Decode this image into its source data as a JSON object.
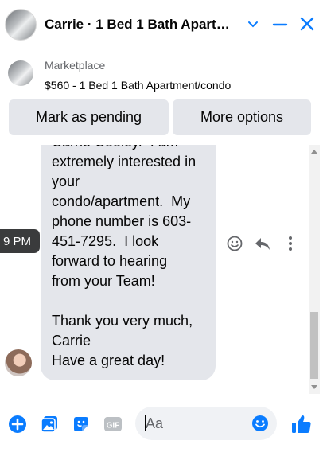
{
  "header": {
    "title": "Carrie · 1 Bed 1 Bath Apart…"
  },
  "marketplace": {
    "label": "Marketplace",
    "listing": "$560 - 1 Bed 1 Bath Apartment/condo",
    "pending_button": "Mark as pending",
    "more_button": "More options"
  },
  "chat": {
    "message": "Carrie Cooley.  I am\nextremely interested in\nyour\ncondo/apartment.  My\nphone number is 603-\n451-7295.  I look\nforward to hearing\nfrom your Team!\n\nThank you very much,\nCarrie\nHave a great day!",
    "timestamp": "9 PM"
  },
  "composer": {
    "placeholder": "Aa",
    "gif_label": "GIF"
  },
  "colors": {
    "accent": "#0a7cff",
    "bubble": "#e4e6eb",
    "tooltip": "#3a3b3c"
  }
}
